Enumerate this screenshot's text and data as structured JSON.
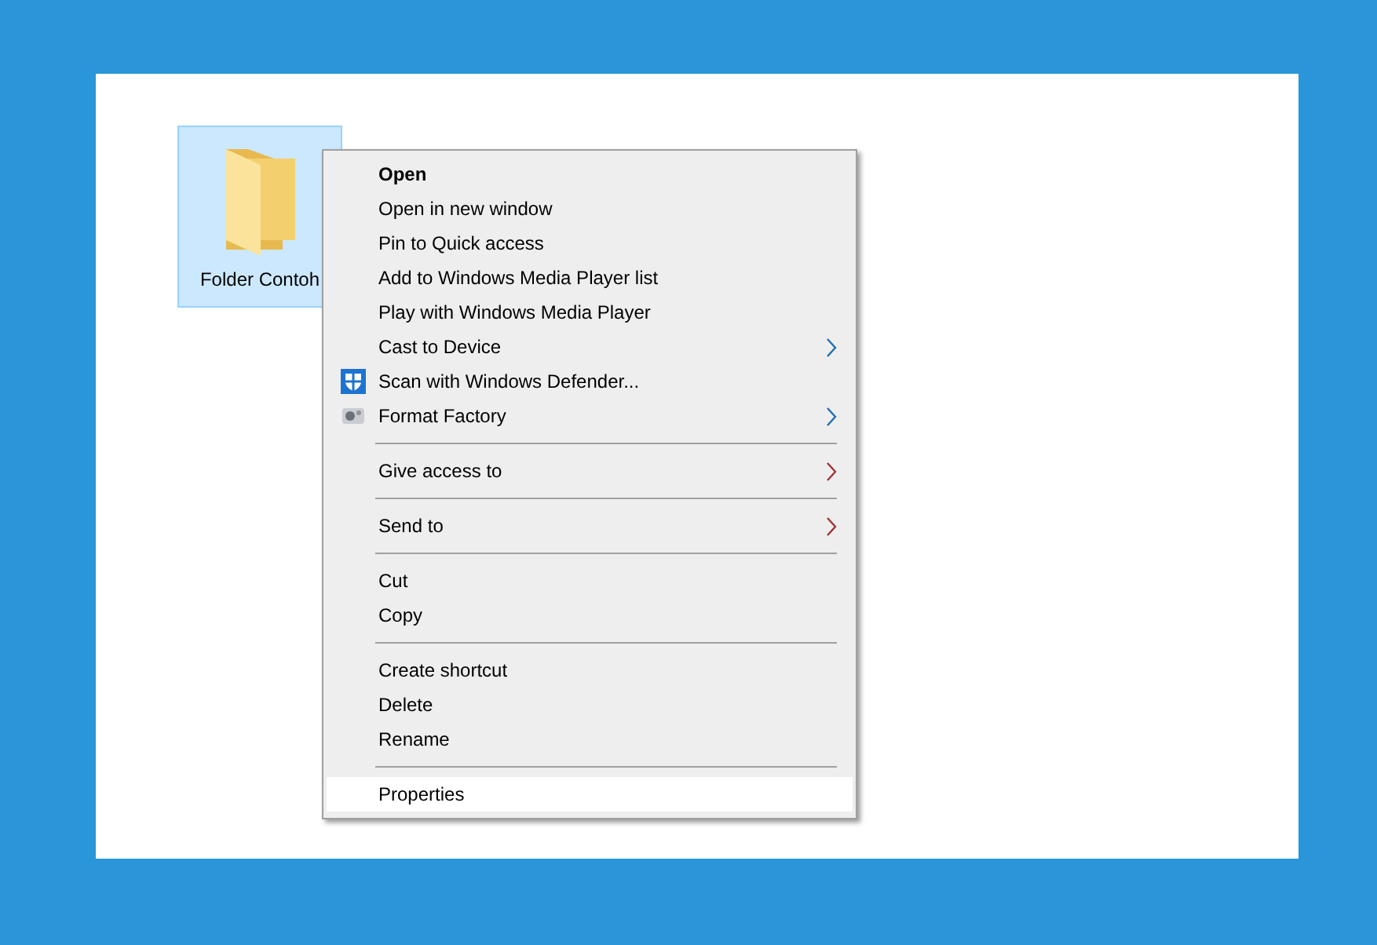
{
  "desktop_item": {
    "label": "Folder Contoh",
    "selected": true
  },
  "context_menu": {
    "groups": [
      {
        "items": [
          {
            "kind": "plain",
            "label": "Open",
            "bold": true,
            "selected": false
          },
          {
            "kind": "plain",
            "label": "Open in new window",
            "bold": false,
            "selected": false
          },
          {
            "kind": "plain",
            "label": "Pin to Quick access",
            "bold": false,
            "selected": false
          },
          {
            "kind": "plain",
            "label": "Add to Windows Media Player list",
            "bold": false,
            "selected": false
          },
          {
            "kind": "plain",
            "label": "Play with Windows Media Player",
            "bold": false,
            "selected": false
          },
          {
            "kind": "plain",
            "label": "Cast to Device",
            "bold": false,
            "selected": false,
            "submenu": true,
            "color": "#1f6fb5"
          },
          {
            "kind": "shield",
            "label": "Scan with Windows Defender...",
            "bold": false,
            "selected": false
          },
          {
            "kind": "app",
            "label": "Format Factory",
            "bold": false,
            "selected": false,
            "submenu": true,
            "color": "#1f6fb5"
          }
        ]
      },
      {
        "items": [
          {
            "kind": "plain",
            "label": "Give access to",
            "bold": false,
            "selected": false,
            "submenu": true,
            "color": "#a3333a"
          }
        ]
      },
      {
        "items": [
          {
            "kind": "plain",
            "label": "Send to",
            "bold": false,
            "selected": false,
            "submenu": true,
            "color": "#a3333a"
          }
        ]
      },
      {
        "items": [
          {
            "kind": "plain",
            "label": "Cut",
            "bold": false,
            "selected": false
          },
          {
            "kind": "plain",
            "label": "Copy",
            "bold": false,
            "selected": false
          }
        ]
      },
      {
        "items": [
          {
            "kind": "plain",
            "label": "Create shortcut",
            "bold": false,
            "selected": false
          },
          {
            "kind": "plain",
            "label": "Delete",
            "bold": false,
            "selected": false
          },
          {
            "kind": "plain",
            "label": "Rename",
            "bold": false,
            "selected": false
          }
        ]
      },
      {
        "items": [
          {
            "kind": "plain",
            "label": "Properties",
            "bold": false,
            "selected": true
          }
        ]
      }
    ]
  }
}
